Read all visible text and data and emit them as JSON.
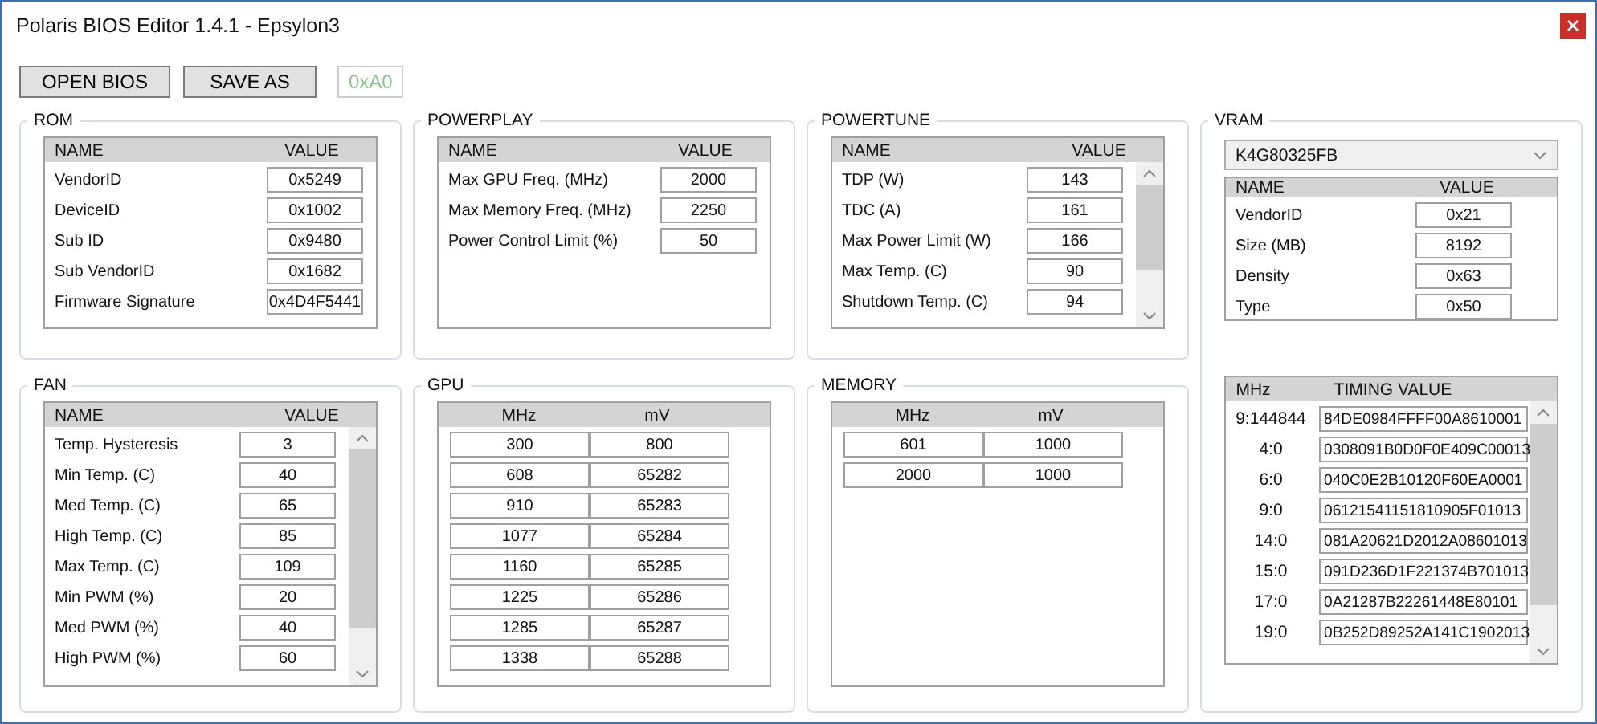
{
  "window": {
    "title": "Polaris BIOS Editor 1.4.1 - Epsylon3"
  },
  "toolbar": {
    "buttons": [
      "OPEN BIOS",
      "SAVE AS"
    ],
    "checksum": "0xA0"
  },
  "rom": {
    "title": "ROM",
    "columns": [
      "NAME",
      "VALUE"
    ],
    "rows": [
      {
        "name": "VendorID",
        "value": "0x5249"
      },
      {
        "name": "DeviceID",
        "value": "0x1002"
      },
      {
        "name": "Sub ID",
        "value": "0x9480"
      },
      {
        "name": "Sub VendorID",
        "value": "0x1682"
      },
      {
        "name": "Firmware Signature",
        "value": "0x4D4F5441"
      }
    ]
  },
  "powerplay": {
    "title": "POWERPLAY",
    "columns": [
      "NAME",
      "VALUE"
    ],
    "rows": [
      {
        "name": "Max GPU Freq. (MHz)",
        "value": "2000"
      },
      {
        "name": "Max Memory Freq. (MHz)",
        "value": "2250"
      },
      {
        "name": "Power Control Limit (%)",
        "value": "50"
      }
    ]
  },
  "powertune": {
    "title": "POWERTUNE",
    "columns": [
      "NAME",
      "VALUE"
    ],
    "rows": [
      {
        "name": "TDP (W)",
        "value": "143"
      },
      {
        "name": "TDC (A)",
        "value": "161"
      },
      {
        "name": "Max Power Limit (W)",
        "value": "166"
      },
      {
        "name": "Max Temp. (C)",
        "value": "90"
      },
      {
        "name": "Shutdown Temp. (C)",
        "value": "94"
      }
    ]
  },
  "vram": {
    "title": "VRAM",
    "dropdown": "K4G80325FB",
    "columns": [
      "NAME",
      "VALUE"
    ],
    "rows": [
      {
        "name": "VendorID",
        "value": "0x21"
      },
      {
        "name": "Size (MB)",
        "value": "8192"
      },
      {
        "name": "Density",
        "value": "0x63"
      },
      {
        "name": "Type",
        "value": "0x50"
      }
    ],
    "timings": {
      "columns": [
        "MHz",
        "TIMING VALUE"
      ],
      "rows": [
        {
          "mhz": "9:144844",
          "value": "84DE0984FFFF00A8610001"
        },
        {
          "mhz": "4:0",
          "value": "0308091B0D0F0E409C00013"
        },
        {
          "mhz": "6:0",
          "value": "040C0E2B10120F60EA0001"
        },
        {
          "mhz": "9:0",
          "value": "06121541151810905F01013"
        },
        {
          "mhz": "14:0",
          "value": "081A20621D2012A08601013"
        },
        {
          "mhz": "15:0",
          "value": "091D236D1F221374B701013"
        },
        {
          "mhz": "17:0",
          "value": "0A21287B22261448E80101"
        },
        {
          "mhz": "19:0",
          "value": "0B252D89252A141C1902013"
        }
      ]
    }
  },
  "fan": {
    "title": "FAN",
    "columns": [
      "NAME",
      "VALUE"
    ],
    "rows": [
      {
        "name": "Temp. Hysteresis",
        "value": "3"
      },
      {
        "name": "Min Temp. (C)",
        "value": "40"
      },
      {
        "name": "Med Temp. (C)",
        "value": "65"
      },
      {
        "name": "High Temp. (C)",
        "value": "85"
      },
      {
        "name": "Max Temp. (C)",
        "value": "109"
      },
      {
        "name": "Min PWM (%)",
        "value": "20"
      },
      {
        "name": "Med PWM (%)",
        "value": "40"
      },
      {
        "name": "High PWM (%)",
        "value": "60"
      }
    ]
  },
  "gpu": {
    "title": "GPU",
    "columns": [
      "MHz",
      "mV"
    ],
    "rows": [
      {
        "mhz": "300",
        "mv": "800"
      },
      {
        "mhz": "608",
        "mv": "65282"
      },
      {
        "mhz": "910",
        "mv": "65283"
      },
      {
        "mhz": "1077",
        "mv": "65284"
      },
      {
        "mhz": "1160",
        "mv": "65285"
      },
      {
        "mhz": "1225",
        "mv": "65286"
      },
      {
        "mhz": "1285",
        "mv": "65287"
      },
      {
        "mhz": "1338",
        "mv": "65288"
      }
    ]
  },
  "memory": {
    "title": "MEMORY",
    "columns": [
      "MHz",
      "mV"
    ],
    "rows": [
      {
        "mhz": "601",
        "mv": "1000"
      },
      {
        "mhz": "2000",
        "mv": "1000"
      }
    ]
  }
}
